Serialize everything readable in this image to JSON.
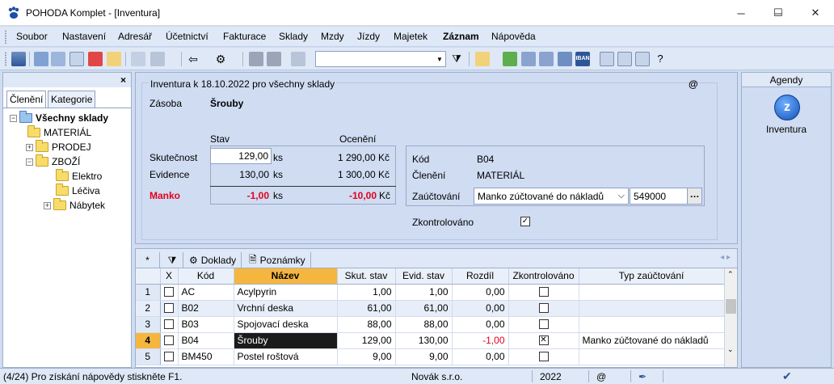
{
  "window": {
    "title": "POHODA Komplet - [Inventura]",
    "icon": "pohoda-paw-icon"
  },
  "menu": [
    "Soubor",
    "Nastavení",
    "Adresář",
    "Účetnictví",
    "Fakturace",
    "Sklady",
    "Mzdy",
    "Jízdy",
    "Majetek",
    "Záznam",
    "Nápověda"
  ],
  "left_panel": {
    "tabs": [
      "Členění",
      "Kategorie"
    ],
    "tree": [
      {
        "label": "Všechny sklady",
        "level": 0,
        "bold": true
      },
      {
        "label": "MATERIÁL",
        "level": 1
      },
      {
        "label": "PRODEJ",
        "level": 1
      },
      {
        "label": "ZBOŽÍ",
        "level": 1
      },
      {
        "label": "Elektro",
        "level": 2
      },
      {
        "label": "Léčiva",
        "level": 2
      },
      {
        "label": "Nábytek",
        "level": 2
      }
    ]
  },
  "form": {
    "group_title": "Inventura k 18.10.2022 pro všechny sklady",
    "at": "@",
    "zasoba_label": "Zásoba",
    "zasoba_value": "Šrouby",
    "col_stav": "Stav",
    "col_oceneni": "Ocenění",
    "skutecnost_label": "Skutečnost",
    "skutecnost_value": "129,00",
    "skutecnost_unit": "ks",
    "skutecnost_price": "1 290,00 Kč",
    "evidence_label": "Evidence",
    "evidence_value": "130,00",
    "evidence_unit": "ks",
    "evidence_price": "1 300,00 Kč",
    "manko_label": "Manko",
    "manko_value": "-1,00",
    "manko_unit": "ks",
    "manko_price": "-10,00",
    "manko_currency": "Kč",
    "kod_label": "Kód",
    "kod_value": "B04",
    "cleneni_label": "Členění",
    "cleneni_value": "MATERIÁL",
    "zauctovani_label": "Zaúčtování",
    "zauctovani_value": "Manko zúčtované do nákladů",
    "account_value": "549000",
    "zkontrolovano_label": "Zkontrolováno",
    "zkontrolovano_checked": "✓"
  },
  "agenda": {
    "header": "Agendy",
    "item": "Inventura"
  },
  "grid": {
    "tabs": [
      "Doklady",
      "Poznámky"
    ],
    "columns": [
      "",
      "X",
      "Kód",
      "Název",
      "Skut. stav",
      "Evid. stav",
      "Rozdíl",
      "Zkontrolováno",
      "Typ zaúčtování"
    ],
    "rows": [
      {
        "no": "1",
        "code": "AC",
        "name": "Acylpyrin",
        "skut": "1,00",
        "evid": "1,00",
        "diff": "0,00",
        "checked": "",
        "typ": ""
      },
      {
        "no": "2",
        "code": "B02",
        "name": "Vrchní deska",
        "skut": "61,00",
        "evid": "61,00",
        "diff": "0,00",
        "checked": "",
        "typ": ""
      },
      {
        "no": "3",
        "code": "B03",
        "name": "Spojovací deska",
        "skut": "88,00",
        "evid": "88,00",
        "diff": "0,00",
        "checked": "",
        "typ": ""
      },
      {
        "no": "4",
        "code": "B04",
        "name": "Šrouby",
        "skut": "129,00",
        "evid": "130,00",
        "diff": "-1,00",
        "checked": "✕",
        "typ": "Manko zúčtované do nákladů"
      },
      {
        "no": "5",
        "code": "BM450",
        "name": "Postel roštová",
        "skut": "9,00",
        "evid": "9,00",
        "diff": "0,00",
        "checked": "",
        "typ": ""
      }
    ]
  },
  "status": {
    "hint": "(4/24) Pro získání nápovědy stiskněte F1.",
    "company": "Novák s.r.o.",
    "year": "2022",
    "at": "@"
  },
  "colors": {
    "selection": "#f5b640",
    "accent": "#1250b8",
    "negative": "#e3001b",
    "panel": "#cfdcf2"
  }
}
